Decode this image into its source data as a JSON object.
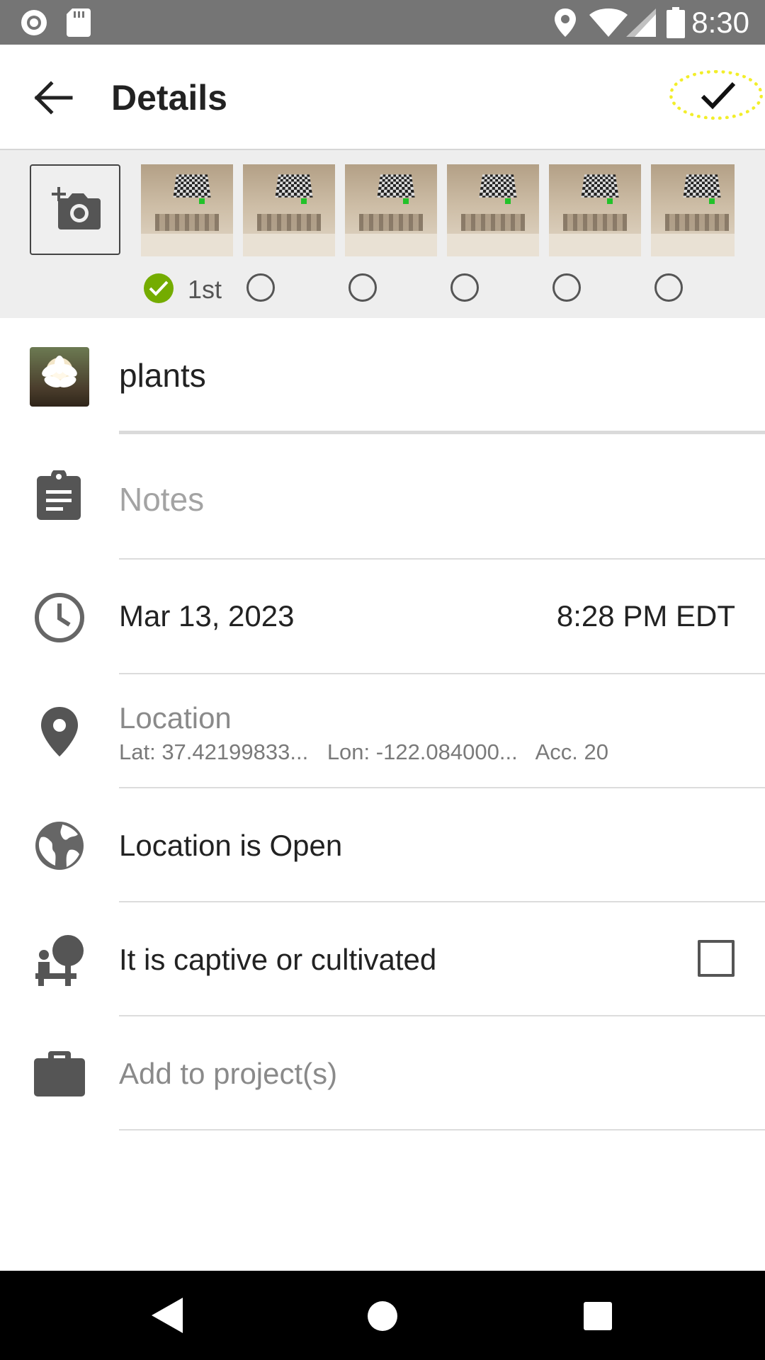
{
  "status_bar": {
    "time": "8:30",
    "icons": [
      "record-icon",
      "sd-card-icon",
      "location-pin-icon",
      "wifi-icon",
      "signal-icon",
      "battery-icon"
    ]
  },
  "toolbar": {
    "title": "Details",
    "back_icon": "arrow-back-icon",
    "done_icon": "checkmark-icon"
  },
  "photos": {
    "add_icon": "add-photo-camera-icon",
    "first_label": "1st",
    "count": 6
  },
  "species": {
    "name": "plants"
  },
  "notes": {
    "placeholder": "Notes"
  },
  "datetime": {
    "date": "Mar 13, 2023",
    "time": "8:28 PM EDT"
  },
  "location": {
    "title": "Location",
    "lat": "Lat: 37.42199833...",
    "lon": "Lon: -122.084000...",
    "acc": "Acc. 20"
  },
  "geoprivacy": {
    "label": "Location is Open"
  },
  "captive": {
    "label": "It is captive or cultivated",
    "checked": false
  },
  "projects": {
    "label": "Add to project(s)"
  },
  "colors": {
    "status_bar": "#757575",
    "accent_green": "#74ac00",
    "highlight_yellow": "#f2ee2a"
  }
}
